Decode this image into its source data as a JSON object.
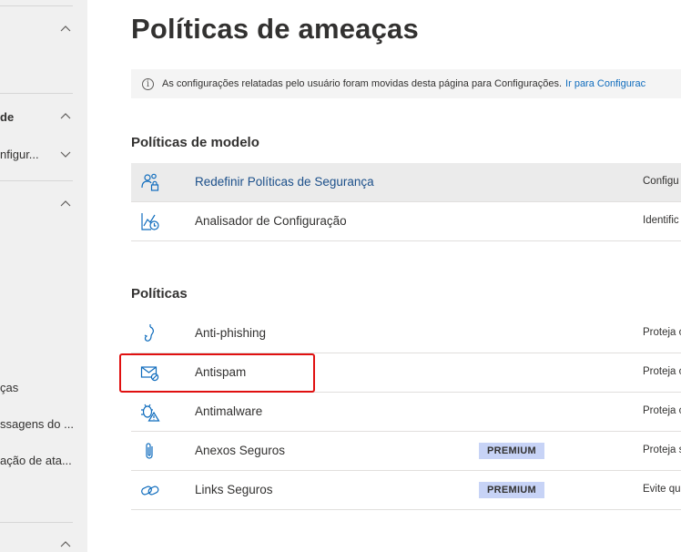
{
  "sidebar": {
    "items": [
      {
        "label": "de",
        "bold": true
      },
      {
        "label": "nfigur..."
      },
      {
        "label": "ças"
      },
      {
        "label": "ssagens do ..."
      },
      {
        "label": "ação de ata..."
      }
    ]
  },
  "page": {
    "title": "Políticas de ameaças"
  },
  "info_bar": {
    "text": "As configurações relatadas pelo usuário foram movidas desta página para Configurações.",
    "link": "Ir para Configurac"
  },
  "template_section": {
    "title": "Políticas de modelo",
    "rows": [
      {
        "name": "Redefinir Políticas de Segurança",
        "desc": "Configu",
        "icon": "users-lock-icon"
      },
      {
        "name": "Analisador de Configuração",
        "desc": "Identific",
        "icon": "chart-clock-icon"
      }
    ]
  },
  "policies_section": {
    "title": "Políticas",
    "rows": [
      {
        "name": "Anti-phishing",
        "desc": "Proteja c",
        "icon": "fishhook-icon"
      },
      {
        "name": "Antispam",
        "desc": "Proteja c",
        "icon": "mail-block-icon"
      },
      {
        "name": "Antimalware",
        "desc": "Proteja c",
        "icon": "bug-warning-icon"
      },
      {
        "name": "Anexos Seguros",
        "desc": "Proteja s",
        "icon": "paperclip-icon",
        "badge": "PREMIUM"
      },
      {
        "name": "Links Seguros",
        "desc": "Evite qu",
        "icon": "link-icon",
        "badge": "PREMIUM"
      }
    ]
  },
  "colors": {
    "accent": "#0f6cbd",
    "highlight": "#e01010",
    "badge": "#c7d3f6"
  }
}
